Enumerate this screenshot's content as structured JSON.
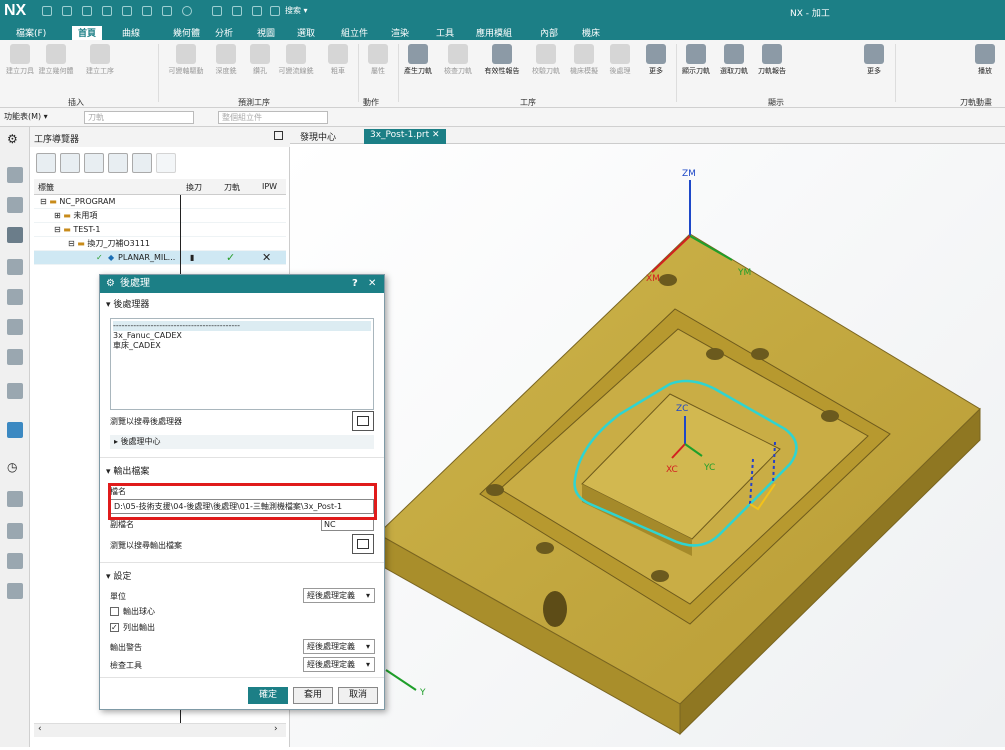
{
  "titlebar": {
    "logo": "NX",
    "search": "搜索 ▾",
    "app_title": "NX - 加工"
  },
  "menu": [
    "檔案(F)",
    "首頁",
    "曲線",
    "幾何體",
    "分析",
    "視圖",
    "選取",
    "組立件",
    "渲染",
    "工具",
    "應用模組",
    "內部",
    "機床"
  ],
  "ribbon": {
    "buttons": [
      "建立刀具",
      "建立幾何體",
      "建立工序",
      "可變軸驅動",
      "深度銑",
      "鑽孔",
      "可變流線銑",
      "粗車",
      "屬性",
      "產生刀軌",
      "檢查刀軌",
      "有效性報告",
      "校驗刀軌",
      "機床模擬",
      "後處理",
      "更多",
      "顯示刀軌",
      "選取刀軌",
      "刀軌報告",
      "更多",
      "播放"
    ],
    "groups": [
      "插入",
      "預測工序",
      "動作",
      "工序",
      "顯示",
      "刀軌動畫"
    ]
  },
  "toolbar2": {
    "menu_label": "功能表(M) ▾",
    "field1": "刀軌",
    "field2": "整個組立件"
  },
  "navigator": {
    "title": "工序導覽器",
    "columns": [
      "標籤",
      "換刀",
      "刀軌",
      "IPW"
    ],
    "rows": [
      {
        "label": "NC_PROGRAM",
        "toolchange": "",
        "path": "",
        "ipw": ""
      },
      {
        "label": "未用項",
        "toolchange": "",
        "path": "",
        "ipw": ""
      },
      {
        "label": "TEST-1",
        "toolchange": "",
        "path": "",
        "ipw": ""
      },
      {
        "label": "換刀_刀補O3111",
        "toolchange": "",
        "path": "",
        "ipw": ""
      },
      {
        "label": "PLANAR_MIL...",
        "toolchange": "▮",
        "path": "✓",
        "ipw": "✕"
      }
    ]
  },
  "tabs": [
    "發現中心",
    "3x_Post-1.prt"
  ],
  "dialog": {
    "title": "後處理",
    "help": "?",
    "close": "✕",
    "postprocessors_header": "後處理器",
    "postprocessors": [
      "--------------------------------------------",
      "3x_Fanuc_CADEX",
      "車床_CADEX"
    ],
    "browse_pp": "瀏覽以搜尋後處理器",
    "pp_center": "後處理中心",
    "output_header": "輸出檔案",
    "filename_label": "檔名",
    "filename_value": "D:\\05-技術支援\\04-後處理\\後處理\\01-三軸測機檔案\\3x_Post-1",
    "ext_label": "副檔名",
    "ext_value": "NC",
    "browse_out": "瀏覽以搜尋輸出檔案",
    "settings_header": "設定",
    "unit_label": "單位",
    "unit_value": "經後處理定義",
    "output_ball": "輸出球心",
    "list_output": "列出輸出",
    "warning_label": "輸出警告",
    "warning_value": "經後處理定義",
    "check_label": "檢查工具",
    "check_value": "經後處理定義",
    "ok": "確定",
    "apply": "套用",
    "cancel": "取消"
  },
  "viewport": {
    "axes": [
      "ZM",
      "XM",
      "YM",
      "ZC",
      "XC",
      "YC",
      "Y"
    ]
  }
}
